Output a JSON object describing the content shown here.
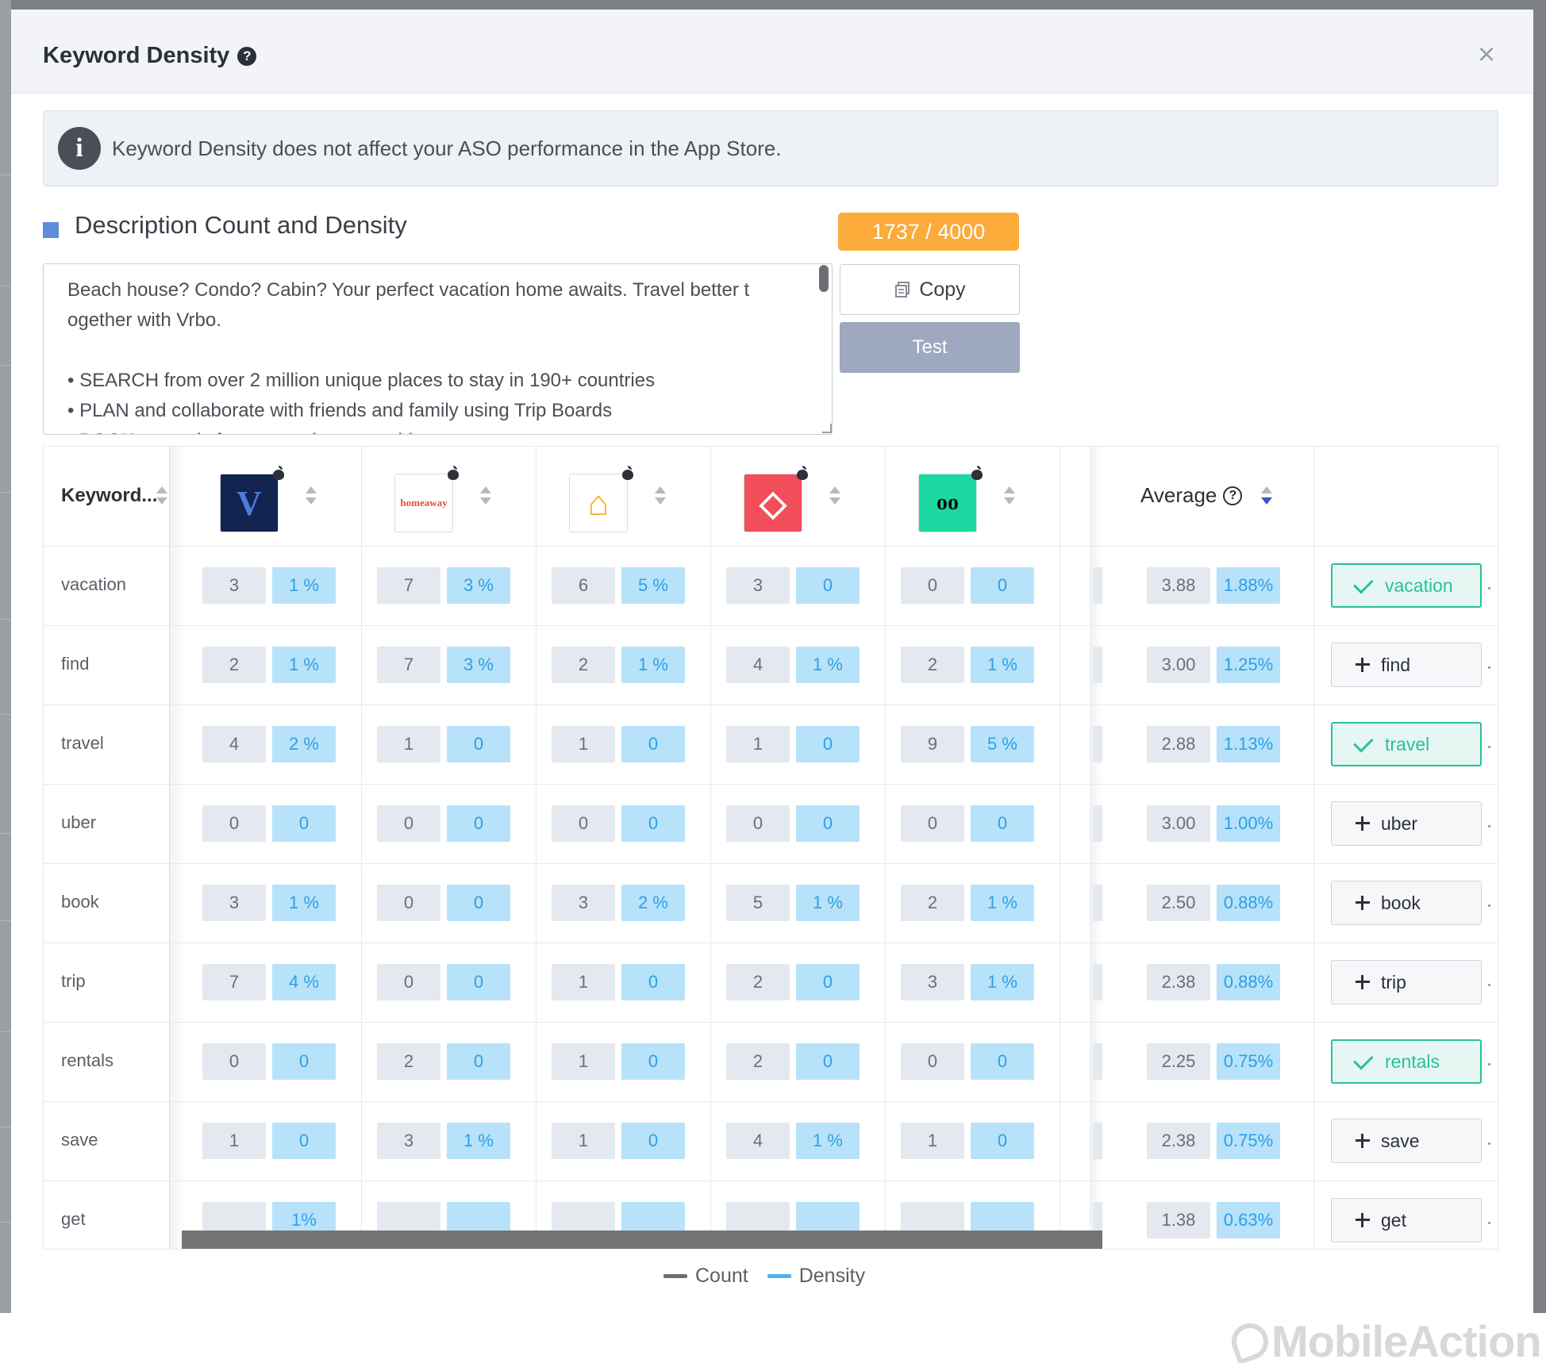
{
  "modal": {
    "title": "Keyword Density",
    "close_label": "×",
    "info_banner": "Keyword Density does not affect your ASO performance in the App Store."
  },
  "section": {
    "title": "Description Count and Density",
    "char_count": "1737 / 4000",
    "copy_label": "Copy",
    "test_label": "Test",
    "description_lines": [
      "Beach house? Condo? Cabin? Your perfect vacation home awaits. Travel better t",
      "ogether with Vrbo.",
      "",
      "• SEARCH from over 2 million unique places to stay in 190+ countries",
      "• PLAN and collaborate with friends and family using Trip Boards",
      "• BOOK securely from your phone or tablet"
    ]
  },
  "table": {
    "keyword_header": "Keyword...",
    "average_header": "Average",
    "apps": [
      {
        "icon": "vrbo-app-icon",
        "text": "V",
        "bg": "#13234f",
        "fg": "#4c7bd9"
      },
      {
        "icon": "homeaway-app-icon",
        "text": "homeaway",
        "bg": "#ffffff",
        "fg": "#e2503b"
      },
      {
        "icon": "house-app-icon",
        "text": "⌂",
        "bg": "#ffffff",
        "fg": "#f4b324"
      },
      {
        "icon": "airbnb-app-icon",
        "text": "◇",
        "bg": "#f24f5a",
        "fg": "#ffffff"
      },
      {
        "icon": "tripadvisor-app-icon",
        "text": "oo",
        "bg": "#1cd9a2",
        "fg": "#111111"
      }
    ],
    "rows": [
      {
        "keyword": "vacation",
        "cells": [
          [
            "3",
            "1 %"
          ],
          [
            "7",
            "3 %"
          ],
          [
            "6",
            "5 %"
          ],
          [
            "3",
            "0"
          ],
          [
            "0",
            "0"
          ]
        ],
        "avg_count": "3.88",
        "avg_density": "1.88%",
        "action": "vacation",
        "added": true
      },
      {
        "keyword": "find",
        "cells": [
          [
            "2",
            "1 %"
          ],
          [
            "7",
            "3 %"
          ],
          [
            "2",
            "1 %"
          ],
          [
            "4",
            "1 %"
          ],
          [
            "2",
            "1 %"
          ]
        ],
        "avg_count": "3.00",
        "avg_density": "1.25%",
        "action": "find",
        "added": false
      },
      {
        "keyword": "travel",
        "cells": [
          [
            "4",
            "2 %"
          ],
          [
            "1",
            "0"
          ],
          [
            "1",
            "0"
          ],
          [
            "1",
            "0"
          ],
          [
            "9",
            "5 %"
          ]
        ],
        "avg_count": "2.88",
        "avg_density": "1.13%",
        "action": "travel",
        "added": true
      },
      {
        "keyword": "uber",
        "cells": [
          [
            "0",
            "0"
          ],
          [
            "0",
            "0"
          ],
          [
            "0",
            "0"
          ],
          [
            "0",
            "0"
          ],
          [
            "0",
            "0"
          ]
        ],
        "avg_count": "3.00",
        "avg_density": "1.00%",
        "action": "uber",
        "added": false
      },
      {
        "keyword": "book",
        "cells": [
          [
            "3",
            "1 %"
          ],
          [
            "0",
            "0"
          ],
          [
            "3",
            "2 %"
          ],
          [
            "5",
            "1 %"
          ],
          [
            "2",
            "1 %"
          ]
        ],
        "avg_count": "2.50",
        "avg_density": "0.88%",
        "action": "book",
        "added": false
      },
      {
        "keyword": "trip",
        "cells": [
          [
            "7",
            "4 %"
          ],
          [
            "0",
            "0"
          ],
          [
            "1",
            "0"
          ],
          [
            "2",
            "0"
          ],
          [
            "3",
            "1 %"
          ]
        ],
        "avg_count": "2.38",
        "avg_density": "0.88%",
        "action": "trip",
        "added": false
      },
      {
        "keyword": "rentals",
        "cells": [
          [
            "0",
            "0"
          ],
          [
            "2",
            "0"
          ],
          [
            "1",
            "0"
          ],
          [
            "2",
            "0"
          ],
          [
            "0",
            "0"
          ]
        ],
        "avg_count": "2.25",
        "avg_density": "0.75%",
        "action": "rentals",
        "added": true
      },
      {
        "keyword": "save",
        "cells": [
          [
            "1",
            "0"
          ],
          [
            "3",
            "1 %"
          ],
          [
            "1",
            "0"
          ],
          [
            "4",
            "1 %"
          ],
          [
            "1",
            "0"
          ]
        ],
        "avg_count": "2.38",
        "avg_density": "0.75%",
        "action": "save",
        "added": false
      },
      {
        "keyword": "get",
        "cells": [
          [
            "",
            "1%"
          ],
          [
            "",
            ""
          ],
          [
            "",
            ""
          ],
          [
            "",
            ""
          ],
          [
            "",
            ""
          ]
        ],
        "avg_count": "1.38",
        "avg_density": "0.63%",
        "action": "get",
        "added": false
      }
    ]
  },
  "legend": {
    "count_label": "Count",
    "density_label": "Density",
    "count_color": "#6b7078",
    "density_color": "#4db3f0"
  },
  "brand": {
    "name": "MobileAction"
  }
}
